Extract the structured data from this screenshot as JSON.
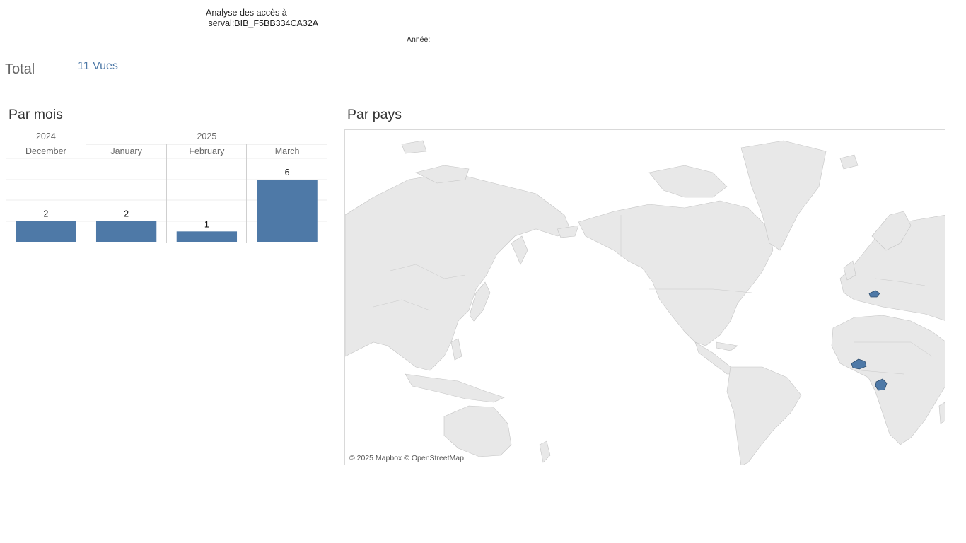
{
  "header": {
    "title": "Analyse des accès à\n serval:BIB_F5BB334CA32A",
    "year_filter_label": "Année:"
  },
  "total": {
    "label": "Total",
    "value": "11 Vues"
  },
  "sections": {
    "monthly_title": "Par mois",
    "country_title": "Par pays"
  },
  "map": {
    "attribution": "© 2025 Mapbox © OpenStreetMap",
    "highlighted_countries": [
      "Switzerland",
      "Burkina Faso",
      "Gabon"
    ]
  },
  "colors": {
    "accent": "#4e79a7",
    "land": "#e7e7e7",
    "border": "#bdbdbd"
  },
  "chart_data": {
    "type": "bar",
    "title": "Par mois",
    "year_headers": [
      {
        "label": "2024",
        "span": 1
      },
      {
        "label": "2025",
        "span": 3
      }
    ],
    "categories": [
      "December",
      "January",
      "February",
      "March"
    ],
    "values": [
      2,
      2,
      1,
      6
    ],
    "ylim": [
      0,
      6
    ],
    "grid": true
  }
}
